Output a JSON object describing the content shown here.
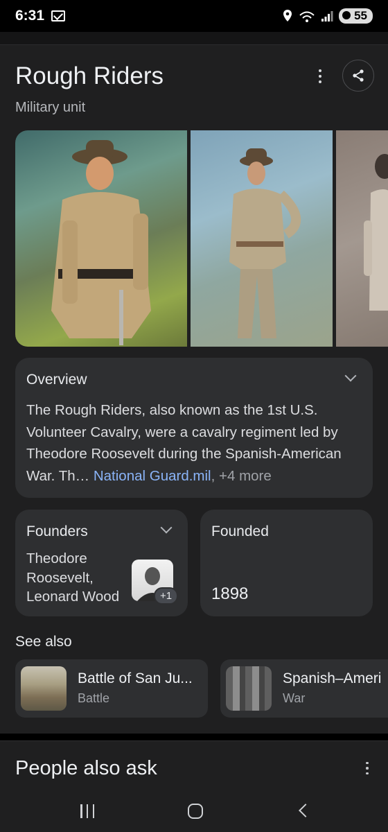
{
  "status_bar": {
    "time": "6:31",
    "battery": "55"
  },
  "knowledge_panel": {
    "title": "Rough Riders",
    "subtitle": "Military unit",
    "overview": {
      "heading": "Overview",
      "text": "The Rough Riders, also known as the 1st U.S. Volunteer Cavalry, were a cavalry regiment led by Theodore Roosevelt during the Spanish-American War. Th",
      "ellipsis": "…",
      "source_link": "National Guard.mil",
      "more_sources": ", +4 more"
    },
    "founders": {
      "heading": "Founders",
      "value": "Theodore Roosevelt, Leonard Wood",
      "extra_count": "+1"
    },
    "founded": {
      "heading": "Founded",
      "value": "1898"
    },
    "see_also": {
      "heading": "See also",
      "items": [
        {
          "title": "Battle of San Ju...",
          "subtitle": "Battle"
        },
        {
          "title": "Spanish–Ameri",
          "subtitle": "War"
        }
      ]
    }
  },
  "people_also_ask": {
    "title": "People also ask"
  },
  "icons": {
    "mail": "mail-icon",
    "location": "location-icon",
    "wifi": "wifi-6e-icon",
    "signal": "signal-icon",
    "battery": "battery-icon",
    "more": "more-vert-icon",
    "share": "share-icon",
    "chevron": "chevron-down-icon",
    "nav_recents": "recents-icon",
    "nav_home": "home-icon",
    "nav_back": "back-icon"
  },
  "colors": {
    "background": "#000000",
    "surface": "#1f1f20",
    "card": "#2e2f31",
    "link": "#8ab4f8",
    "text_primary": "#e8eaed",
    "text_secondary": "#a0a3a8"
  }
}
